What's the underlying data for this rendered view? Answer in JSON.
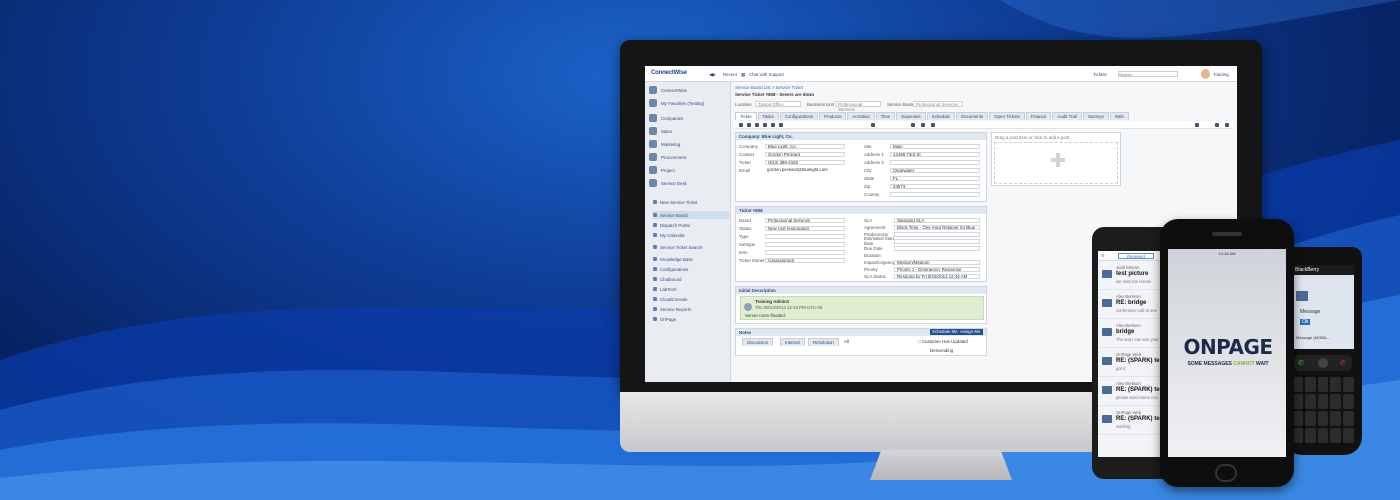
{
  "app": {
    "logo": "ConnectWise",
    "topbar": {
      "recent": "Recent",
      "chat": "Chat with Support",
      "search_scope": "Tickets",
      "search_placeholder": "Search",
      "user": "Training"
    }
  },
  "sidebar": {
    "items": [
      {
        "label": "ConnectWise"
      },
      {
        "label": "My Favorites (Testing)"
      },
      {
        "label": "Companies"
      },
      {
        "label": "Sales"
      },
      {
        "label": "Marketing"
      },
      {
        "label": "Procurement"
      },
      {
        "label": "Project"
      },
      {
        "label": "Service Desk"
      }
    ],
    "sub_items": [
      {
        "label": "New Service Ticket"
      },
      {
        "label": "Service Board"
      },
      {
        "label": "Dispatch Portal"
      },
      {
        "label": "My Calendar"
      },
      {
        "label": "Service Ticket Search"
      },
      {
        "label": "Knowledge Base"
      },
      {
        "label": "Configurations"
      },
      {
        "label": "Chatbound"
      },
      {
        "label": "LabTech"
      },
      {
        "label": "CloudConsole"
      },
      {
        "label": "Service Reports"
      },
      {
        "label": "OnPage"
      }
    ]
  },
  "ticket": {
    "breadcrumb": "Service Board List > Service Ticket",
    "title": "Service Ticket #808 - Severs are down",
    "filters": {
      "location_label": "Location",
      "location_value": "Tampa Office",
      "business_unit_label": "Business Unit",
      "business_unit_value": "Professional Services",
      "board_label": "Service Board",
      "board_value": "Professional Services"
    },
    "tabs": [
      "Ticket",
      "Tasks",
      "Configurations",
      "Products",
      "Activities",
      "Time",
      "Expenses",
      "Schedule",
      "Documents",
      "Open Tickets",
      "Finance",
      "Audit Trail",
      "Surveys",
      "Web"
    ],
    "company_panel": {
      "header": "Company: Blue Light, Co.",
      "fields": [
        {
          "label": "Company",
          "value": "Blue Light, Co."
        },
        {
          "label": "Contact",
          "value": "Gordon Peckard"
        },
        {
          "label": "Ticket",
          "value": "(813) 396-4160"
        },
        {
          "label": "Email",
          "value": "gordon.peckard@bluelight.com"
        }
      ],
      "address_fields": [
        {
          "label": "Site",
          "value": "Main"
        },
        {
          "label": "Address 1",
          "value": "12466 73rd St"
        },
        {
          "label": "Address 2",
          "value": ""
        },
        {
          "label": "City",
          "value": "Clearwater"
        },
        {
          "label": "State",
          "value": "FL"
        },
        {
          "label": "Zip",
          "value": "33673"
        },
        {
          "label": "Country",
          "value": ""
        }
      ]
    },
    "drop_zone": "Drag a post here or click to add a post",
    "info_panel": {
      "header": "Ticket #808",
      "fields": [
        {
          "label": "Board",
          "value": "Professional Services"
        },
        {
          "label": "Status",
          "value": "New (not responded)"
        },
        {
          "label": "Type",
          "value": ""
        },
        {
          "label": "Subtype",
          "value": ""
        },
        {
          "label": "Item",
          "value": ""
        },
        {
          "label": "Ticket Owner",
          "value": "(Unassigned)"
        }
      ],
      "sla_fields": [
        {
          "label": "SLA",
          "value": "Standard SLA"
        },
        {
          "label": "Agreement",
          "value": "Block Time - One Area Retainer for Blue"
        },
        {
          "label": "Predecessor",
          "value": ""
        },
        {
          "label": "Estimated Start Date",
          "value": ""
        },
        {
          "label": "Due Date",
          "value": ""
        },
        {
          "label": "Duration",
          "value": ""
        },
        {
          "label": "Impact/Urgency",
          "value": "Medium/Medium"
        },
        {
          "label": "Priority",
          "value": "Priority 1 - Emergency Response"
        },
        {
          "label": "SLA Status",
          "value": "Respond by Fri 8/15/2014 12:44 AM"
        }
      ]
    },
    "initial_description": {
      "header": "Initial Description",
      "author": "Training Admin1",
      "date": "Thu 08/14/2014 12:44 PM UTC-04",
      "text": "Server room flooded."
    },
    "notes": {
      "header": "Notes",
      "schedule_btn": "Schedule Me",
      "assign_btn": "Assign Me",
      "filters": [
        "Discussion",
        "Internal",
        "Resolution",
        "All"
      ],
      "customer_updated": "Customer Has Updated",
      "sort": "Descending"
    }
  },
  "phone_android": {
    "inbox_label": "Received",
    "messages": [
      {
        "sender": "Judit Sharon",
        "subject": "test picture",
        "body": "we miss the renam"
      },
      {
        "sender": "Alex Berkson",
        "subject": "RE: bridge",
        "body": "conference call at one"
      },
      {
        "sender": "Alex Berkson",
        "subject": "bridge",
        "body": "The text I can see your"
      },
      {
        "sender": "OnPage Web",
        "subject": "RE: (SPARK) test",
        "body": "got it"
      },
      {
        "sender": "Alex Berkson",
        "subject": "RE: (SPARK) test",
        "body": "please send some con"
      },
      {
        "sender": "OnPage Web",
        "subject": "RE: (SPARK) test",
        "body": "working"
      }
    ]
  },
  "phone_iphone": {
    "status": "10:38 AM",
    "logo": "ONPAGE",
    "tagline_start": "SOME MESSAGES ",
    "tagline_accent": "CANNOT",
    "tagline_end": " WAIT"
  },
  "phone_blackberry": {
    "brand": "BlackBerry",
    "message": "Message",
    "ok": "Ok",
    "message2": "Message (MOBIL..."
  },
  "colors": {
    "brand_blue": "#174a8b",
    "onpage_navy": "#1d2a4b",
    "onpage_green": "#7cb342"
  }
}
